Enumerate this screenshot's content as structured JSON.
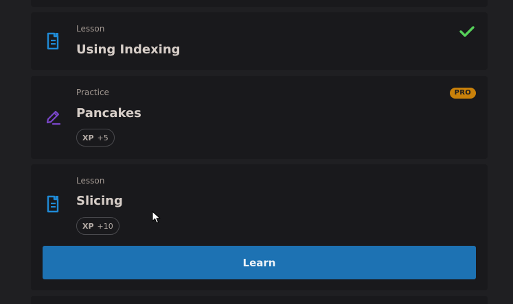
{
  "items": [
    {
      "kind": "Lesson",
      "title": "Using Indexing",
      "status": "completed",
      "icon": "lesson-document-icon"
    },
    {
      "kind": "Practice",
      "title": "Pancakes",
      "badge": "PRO",
      "xp_label": "XP",
      "xp_value": "+5",
      "icon": "practice-pencil-icon"
    },
    {
      "kind": "Lesson",
      "title": "Slicing",
      "xp_label": "XP",
      "xp_value": "+10",
      "icon": "lesson-document-icon",
      "button_label": "Learn"
    }
  ],
  "colors": {
    "background": "#1f1f22",
    "card": "#19191c",
    "accent_blue": "#1d72b3",
    "lesson_icon": "#1f8ad6",
    "practice_icon": "#7a46c9",
    "check_green": "#56d15a",
    "pro_badge": "#c9810a"
  }
}
